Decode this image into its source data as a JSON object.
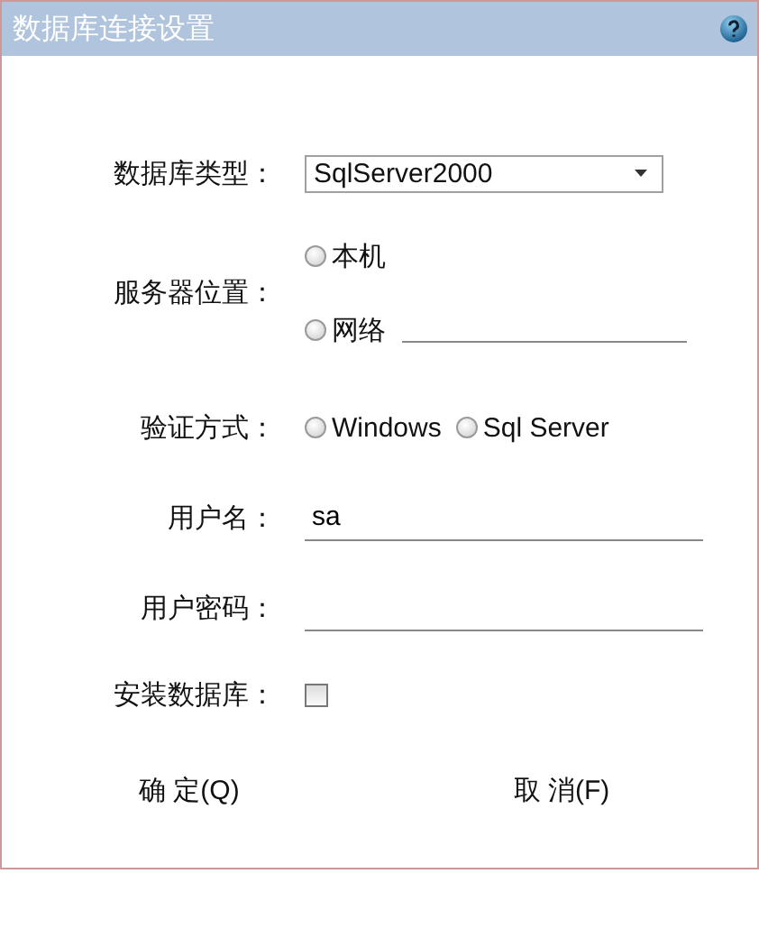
{
  "window": {
    "title": "数据库连接设置"
  },
  "form": {
    "db_type": {
      "label": "数据库类型：",
      "value": "SqlServer2000"
    },
    "server_location": {
      "label": "服务器位置：",
      "options": [
        {
          "kind": "plain",
          "label": "本机",
          "selected": false
        },
        {
          "kind": "address",
          "label": "网络",
          "selected": false
        }
      ]
    },
    "auth_mode": {
      "label": "验证方式：",
      "options": [
        {
          "label": "Windows",
          "selected": false
        },
        {
          "label": "Sql Server",
          "selected": false
        }
      ]
    },
    "username": {
      "label": "用户名：",
      "value": "sa"
    },
    "password": {
      "label": "用户密码："
    },
    "install_database": {
      "label": "安装数据库：",
      "checked": false
    }
  },
  "buttons": [
    {
      "label": "确 定(Q)"
    },
    {
      "label": "取 消(F)"
    }
  ]
}
